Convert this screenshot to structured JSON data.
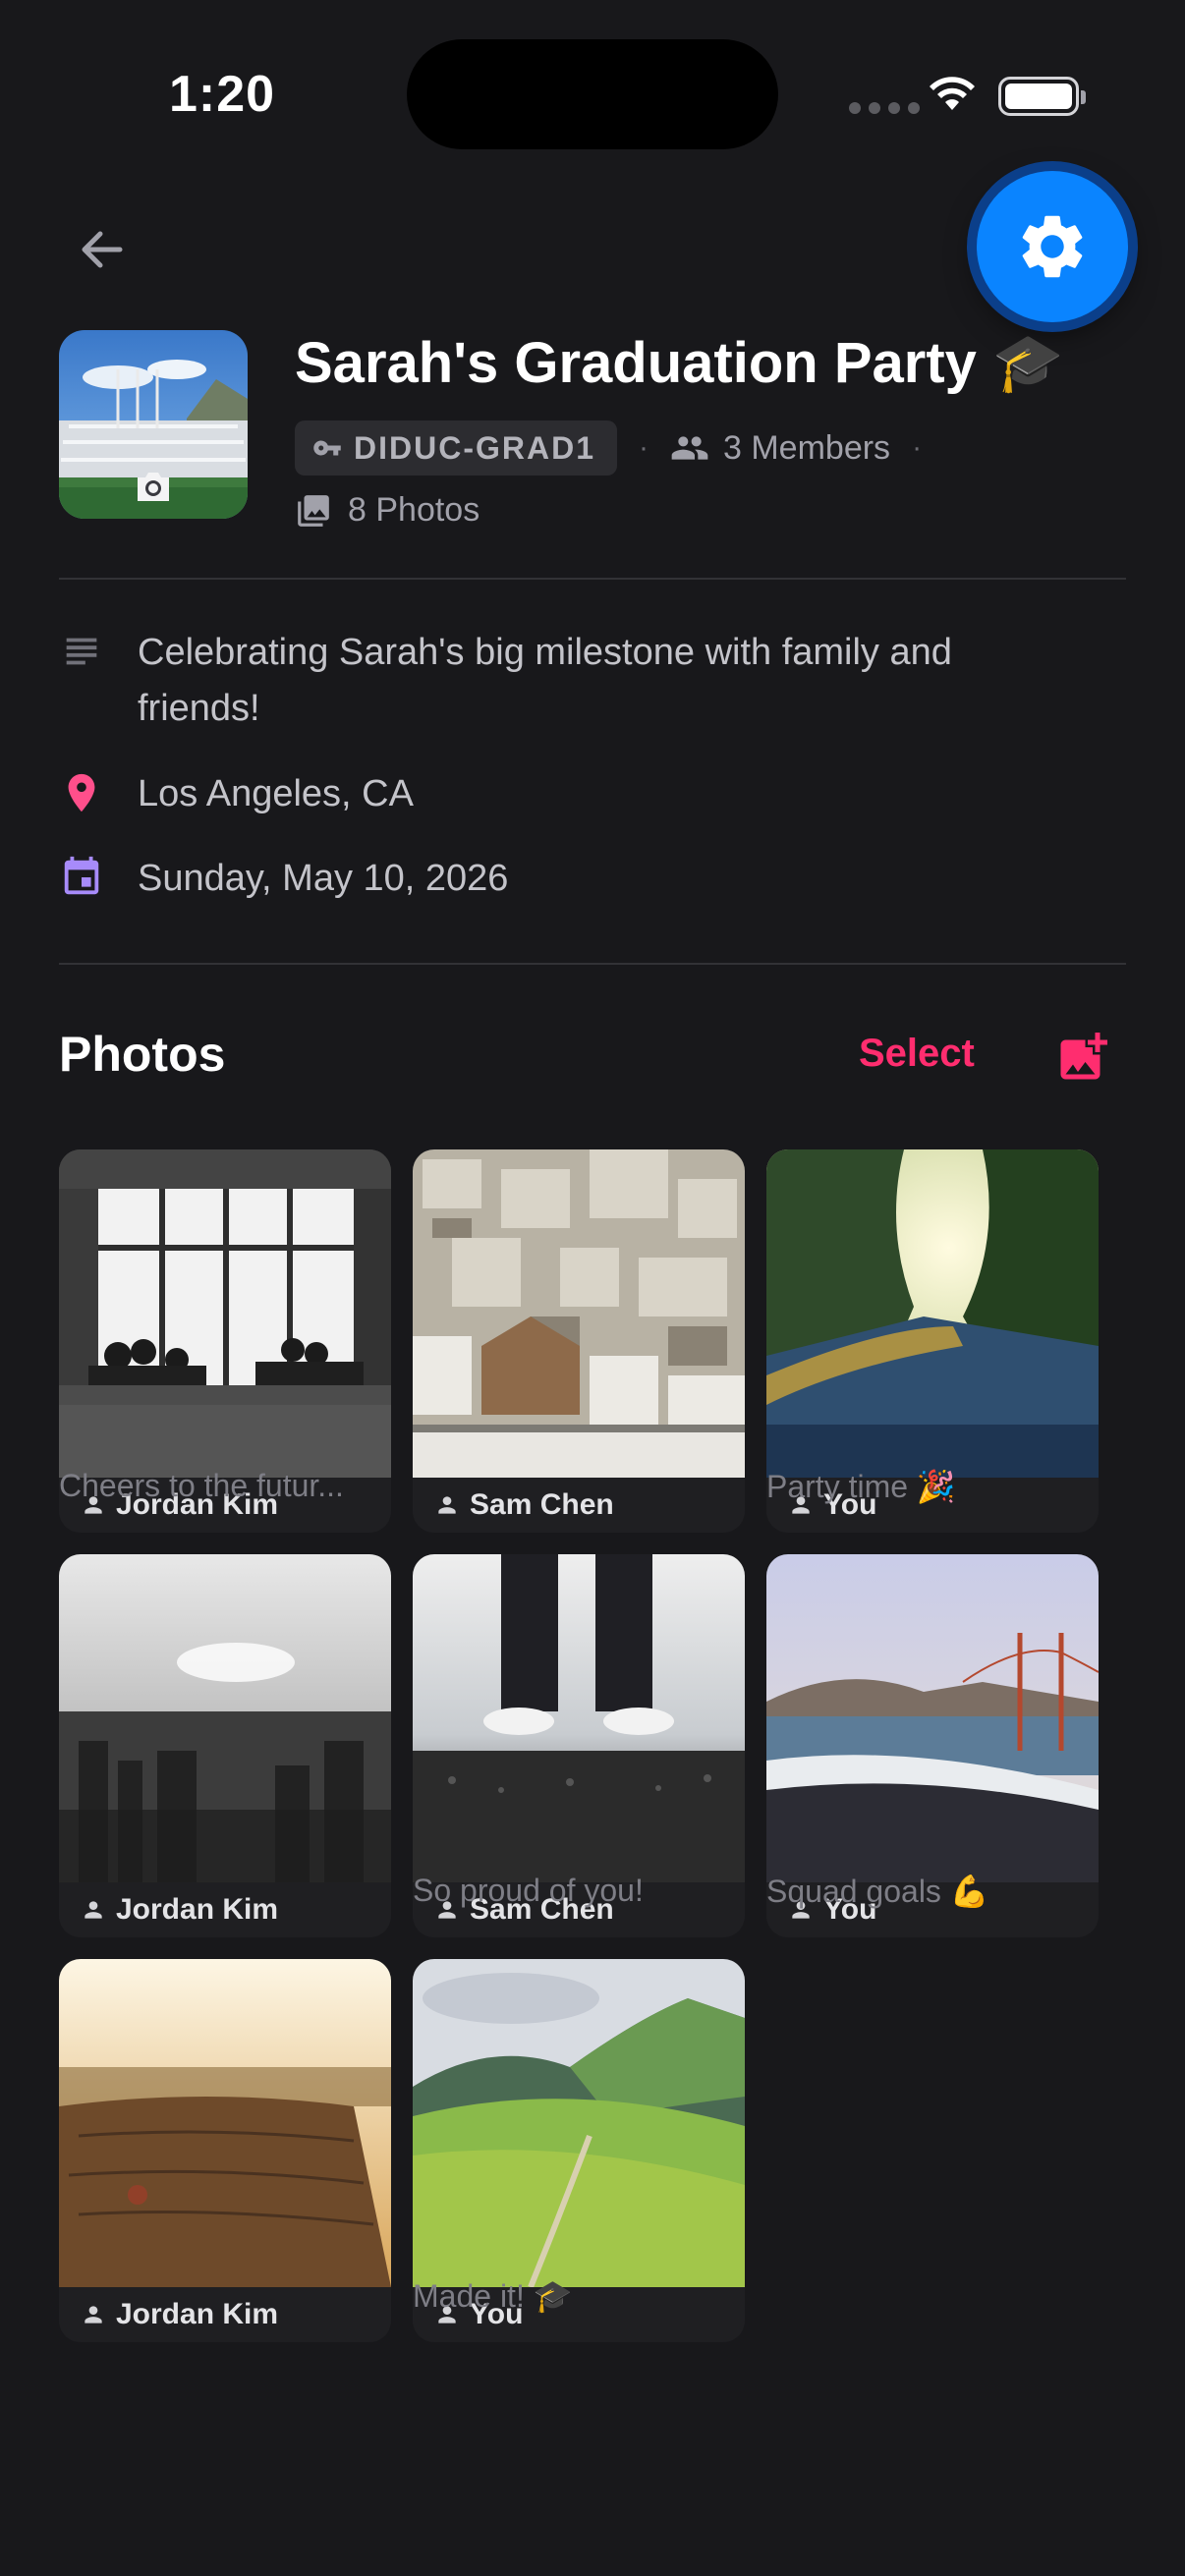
{
  "status_bar": {
    "time": "1:20"
  },
  "header": {
    "back_icon": "arrow-left-icon",
    "settings_icon": "gear-icon",
    "title": "Sarah's Graduation Party 🎓",
    "code": "DIDUC-GRAD1",
    "members": "3 Members",
    "photos": "8 Photos",
    "separator": "·"
  },
  "details": {
    "description": "Celebrating Sarah's big milestone with family and friends!",
    "location": "Los Angeles, CA",
    "date": "Sunday, May 10, 2026"
  },
  "photos_section": {
    "title": "Photos",
    "select_label": "Select",
    "add_icon": "add-photo-icon"
  },
  "photos": [
    {
      "uploader": "Jordan Kim",
      "caption": "Cheers to the futur..."
    },
    {
      "uploader": "Sam Chen",
      "caption": ""
    },
    {
      "uploader": "You",
      "caption": "Party time 🎉"
    },
    {
      "uploader": "Jordan Kim",
      "caption": ""
    },
    {
      "uploader": "Sam Chen",
      "caption": "So proud of you!"
    },
    {
      "uploader": "You",
      "caption": "Squad goals 💪"
    },
    {
      "uploader": "Jordan Kim",
      "caption": ""
    },
    {
      "uploader": "You",
      "caption": "Made it! 🎓"
    }
  ],
  "colors": {
    "background": "#18181b",
    "accent": "#ff2d6f",
    "settings_blue": "#0a84ff",
    "location_pin": "#ff4f8b",
    "calendar": "#a78bfa"
  }
}
